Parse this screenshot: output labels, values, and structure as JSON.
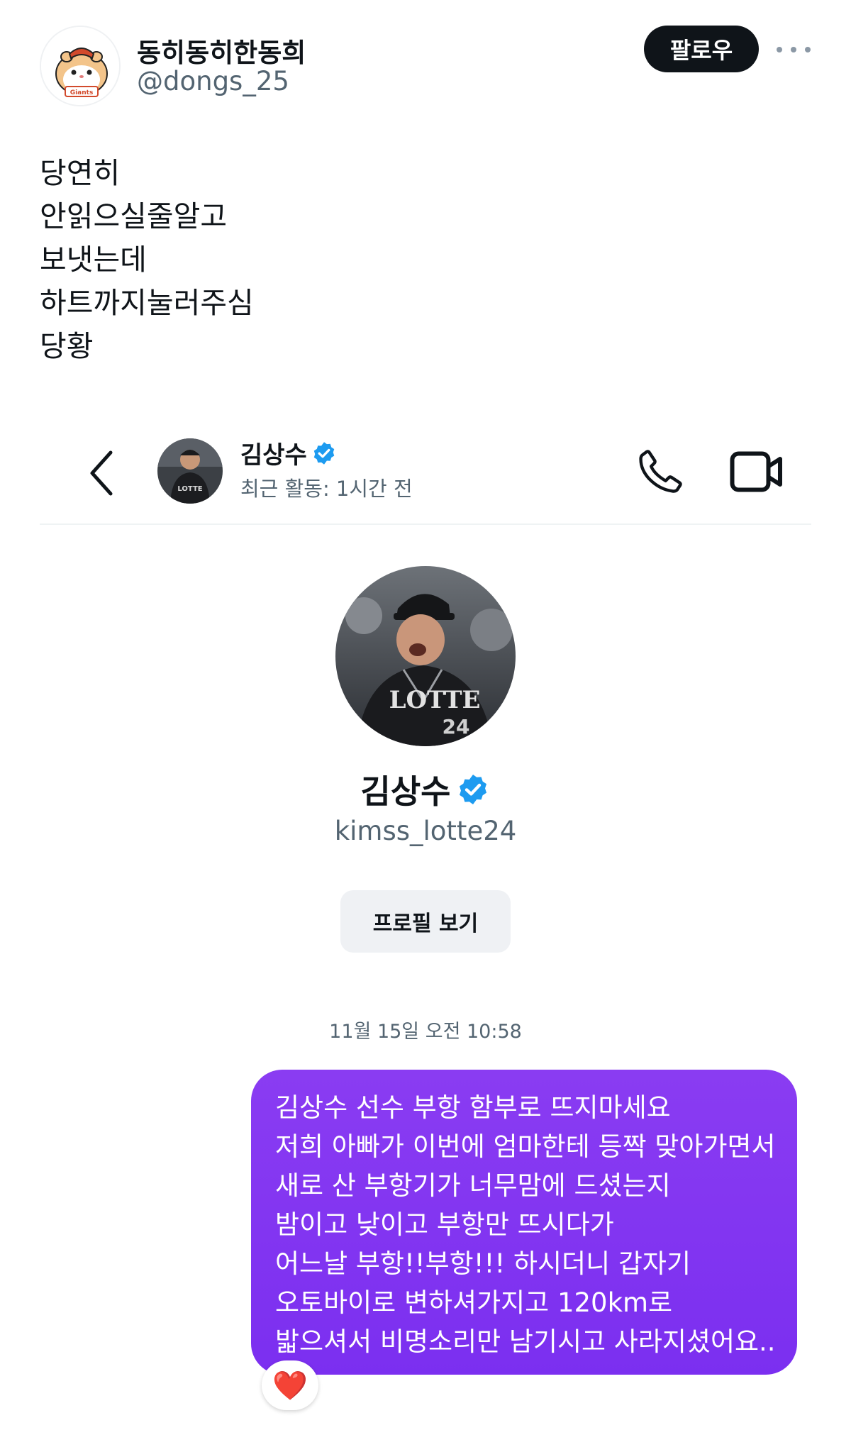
{
  "tweet": {
    "author_name": "동히동히한동희",
    "author_handle": "@dongs_25",
    "follow_label": "팔로우",
    "avatar_badge_text": "Giants",
    "body_lines": [
      "당연히",
      "안읽으실줄알고",
      "보냇는데",
      "하트까지눌러주심",
      "당황"
    ]
  },
  "dm": {
    "header": {
      "contact_name": "김상수",
      "activity": "최근 활동: 1시간 전"
    },
    "profile": {
      "name": "김상수",
      "handle": "kimss_lotte24",
      "view_profile_label": "프로필 보기",
      "jersey_text": "LOTTE",
      "jersey_number": "24"
    },
    "timestamp": "11월 15일 오전 10:58",
    "message_lines": [
      "김상수 선수 부항 함부로 뜨지마세요",
      "저희 아빠가 이번에 엄마한테 등짝 맞아가면서",
      "새로 산 부항기가 너무맘에 드셨는지",
      "밤이고 낮이고 부항만 뜨시다가",
      "어느날 부항!!부항!!! 하시더니 갑자기",
      "오토바이로 변하셔가지고 120km로",
      "밟으셔서 비명소리만 남기시고 사라지셨어요.."
    ],
    "reaction": "❤️"
  },
  "colors": {
    "bubble": "#7b2ff0",
    "verified": "#1d9bf0",
    "follow_bg": "#0f1419",
    "secondary_text": "#536471"
  },
  "icons": [
    "more-icon",
    "back-icon",
    "verified-badge-icon",
    "phone-icon",
    "video-call-icon",
    "heart-reaction-icon"
  ]
}
